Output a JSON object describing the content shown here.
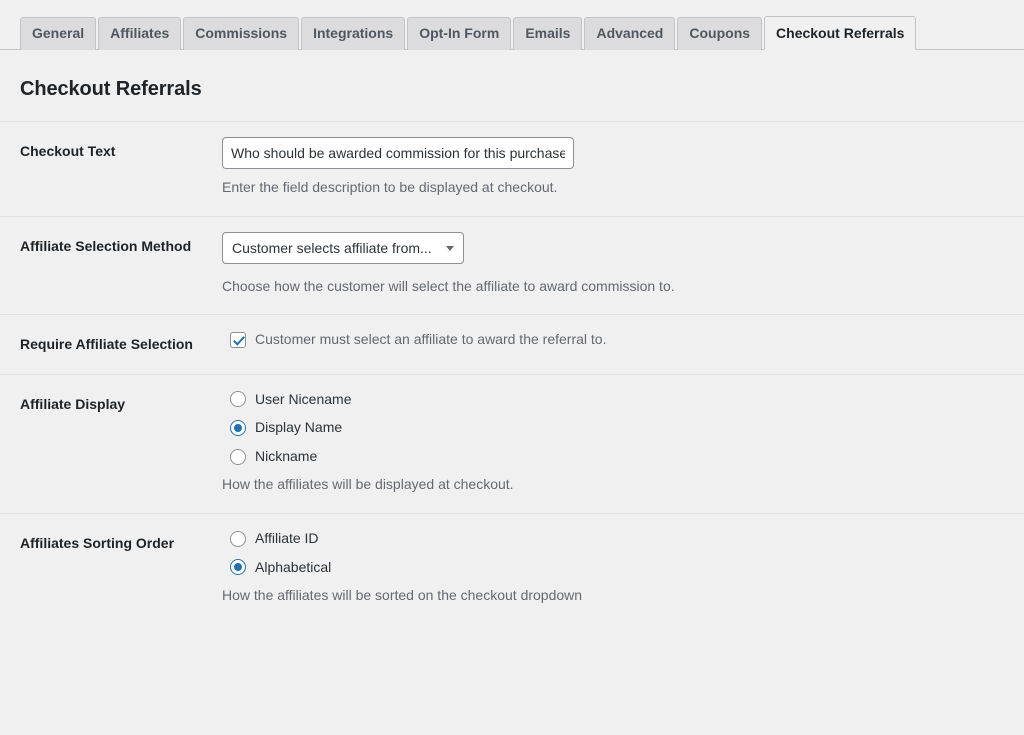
{
  "tabs": [
    {
      "label": "General",
      "active": false
    },
    {
      "label": "Affiliates",
      "active": false
    },
    {
      "label": "Commissions",
      "active": false
    },
    {
      "label": "Integrations",
      "active": false
    },
    {
      "label": "Opt-In Form",
      "active": false
    },
    {
      "label": "Emails",
      "active": false
    },
    {
      "label": "Advanced",
      "active": false
    },
    {
      "label": "Coupons",
      "active": false
    },
    {
      "label": "Checkout Referrals",
      "active": true
    }
  ],
  "page": {
    "title": "Checkout Referrals"
  },
  "rows": {
    "checkout_text": {
      "label": "Checkout Text",
      "value": "Who should be awarded commission for this purchase?",
      "placeholder": "",
      "description": "Enter the field description to be displayed at checkout."
    },
    "selection_method": {
      "label": "Affiliate Selection Method",
      "selected": "Customer selects affiliate from...",
      "description": "Choose how the customer will select the affiliate to award commission to."
    },
    "require_selection": {
      "label": "Require Affiliate Selection",
      "checkbox_label": "Customer must select an affiliate to award the referral to.",
      "checked": true
    },
    "affiliate_display": {
      "label": "Affiliate Display",
      "options": [
        {
          "label": "User Nicename",
          "checked": false
        },
        {
          "label": "Display Name",
          "checked": true
        },
        {
          "label": "Nickname",
          "checked": false
        }
      ],
      "description": "How the affiliates will be displayed at checkout."
    },
    "sorting_order": {
      "label": "Affiliates Sorting Order",
      "options": [
        {
          "label": "Affiliate ID",
          "checked": false
        },
        {
          "label": "Alphabetical",
          "checked": true
        }
      ],
      "description": "How the affiliates will be sorted on the checkout dropdown"
    }
  },
  "colors": {
    "page_background": "#f0f0f1",
    "accent": "#2271b1",
    "tab_inactive_background": "#dcdcde",
    "border": "#c3c4c7",
    "text": "#1d2327",
    "muted_text": "#646970"
  }
}
